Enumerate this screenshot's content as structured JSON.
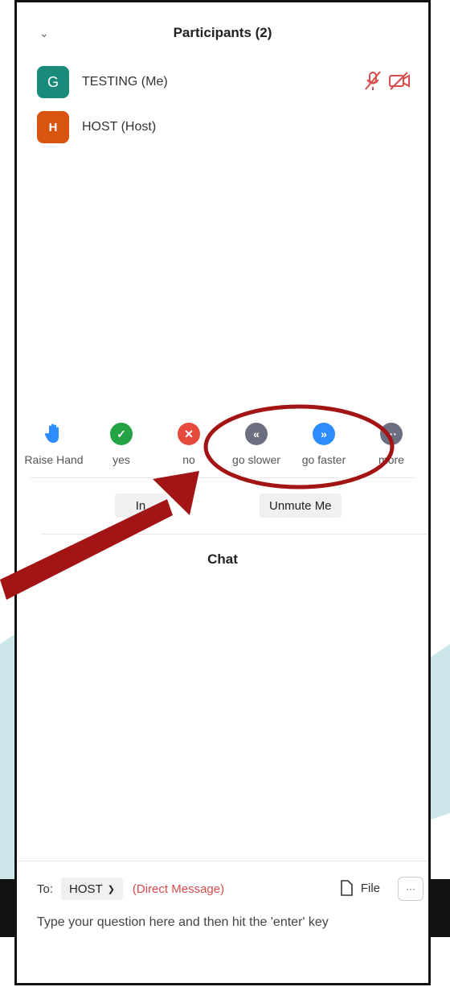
{
  "participants_panel": {
    "title": "Participants (2)",
    "participants": [
      {
        "initial": "G",
        "name": "TESTING (Me)",
        "avatar_color": "#1a8a7a"
      },
      {
        "initial": "H",
        "name": "HOST (Host)",
        "avatar_color": "#d9540f"
      }
    ],
    "status_icons": [
      "mic-muted-icon",
      "video-off-icon"
    ]
  },
  "reactions": [
    {
      "label": "Raise Hand",
      "icon": "raise-hand-icon",
      "color": "#2d8cff"
    },
    {
      "label": "yes",
      "icon": "check-icon",
      "color": "#25a244"
    },
    {
      "label": "no",
      "icon": "x-icon",
      "color": "#e64a3c"
    },
    {
      "label": "go slower",
      "icon": "rewind-icon",
      "color": "#6c6f80"
    },
    {
      "label": "go faster",
      "icon": "fast-forward-icon",
      "color": "#2d8cff"
    },
    {
      "label": "more",
      "icon": "ellipsis-icon",
      "color": "#6c6f80"
    }
  ],
  "buttons": {
    "invite_partial": "In",
    "unmute": "Unmute Me"
  },
  "chat": {
    "title": "Chat",
    "to_label": "To:",
    "recipient": "HOST",
    "direct_message": "(Direct Message)",
    "file_label": "File",
    "placeholder": "Type your question here and then hit the 'enter' key"
  },
  "annotation": {
    "color": "#a31414"
  }
}
